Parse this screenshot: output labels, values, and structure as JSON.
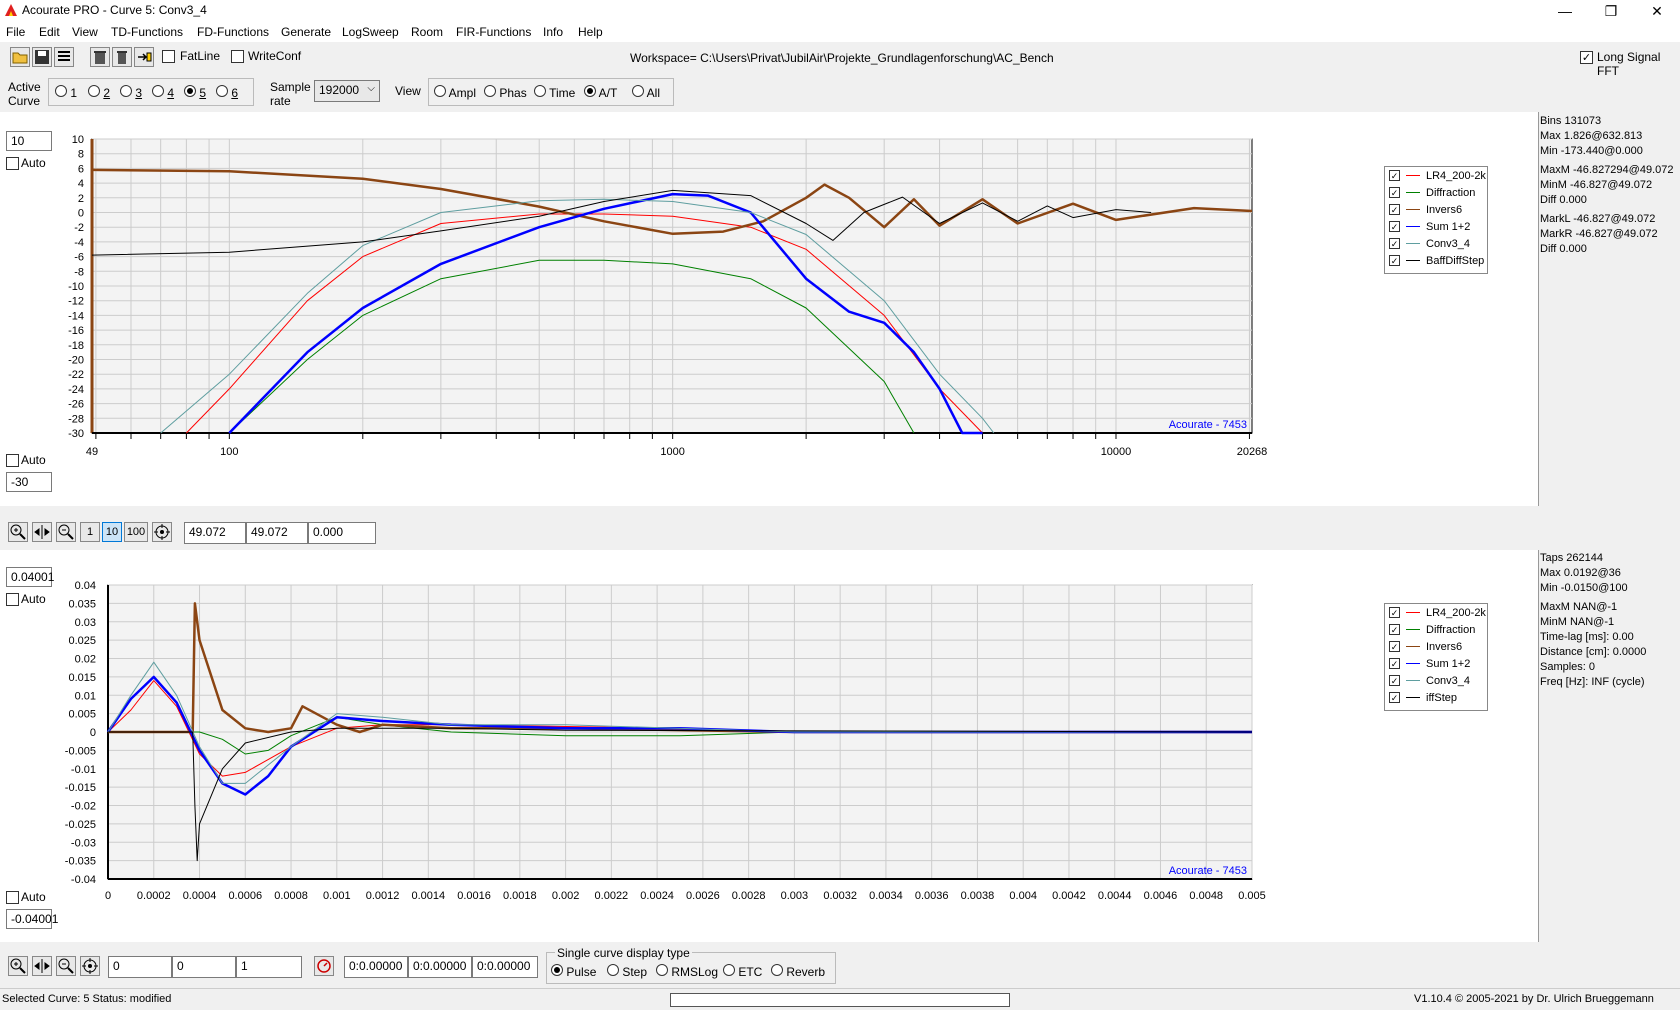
{
  "window": {
    "title": "Acourate PRO - Curve 5: Conv3_4",
    "minimize": "—",
    "restore": "❐",
    "close": "✕"
  },
  "menu": [
    "File",
    "Edit",
    "View",
    "TD-Functions",
    "FD-Functions",
    "Generate",
    "LogSweep",
    "Room",
    "FIR-Functions",
    "Info",
    "Help"
  ],
  "toolbar": {
    "fatline_label": "FatLine",
    "writeconf_label": "WriteConf",
    "workspace": "Workspace= C:\\Users\\Privat\\JubilAir\\Projekte_Grundlagenforschung\\AC_Bench",
    "long_signal_fft_label": "Long Signal FFT"
  },
  "controls": {
    "active_curve_label": "Active Curve",
    "curves": [
      "1",
      "2",
      "3",
      "4",
      "5",
      "6"
    ],
    "active_curve": "5",
    "sample_rate_label": "Sample rate",
    "sample_rate": "192000",
    "view_label": "View",
    "views": [
      "Ampl",
      "Phas",
      "Time",
      "A/T",
      "All"
    ],
    "active_view": "A/T"
  },
  "top_plot": {
    "ymax_value": "10",
    "ymin_value": "-30",
    "auto_label": "Auto",
    "watermark": "Acourate - 7453",
    "yticks": [
      "10",
      "8",
      "6",
      "4",
      "2",
      "0",
      "-2",
      "-4",
      "-6",
      "-8",
      "-10",
      "-12",
      "-14",
      "-16",
      "-18",
      "-20",
      "-22",
      "-24",
      "-26",
      "-28",
      "-30"
    ],
    "xticks": [
      {
        "label": "49",
        "f": 49
      },
      {
        "label": "100",
        "f": 100
      },
      {
        "label": "1000",
        "f": 1000
      },
      {
        "label": "10000",
        "f": 10000
      },
      {
        "label": "20268",
        "f": 20268
      }
    ],
    "info": [
      "Bins 131073",
      "Max 1.826@632.813",
      "Min -173.440@0.000",
      "",
      "MaxM -46.827294@49.072",
      "MinM -46.827@49.072",
      "Diff 0.000",
      "",
      "MarkL -46.827@49.072",
      "MarkR -46.827@49.072",
      "Diff 0.000"
    ]
  },
  "mid_toolbar": {
    "zoom_1": "1",
    "zoom_10": "10",
    "zoom_100": "100",
    "field1": "49.072",
    "field2": "49.072",
    "field3": "0.000"
  },
  "bottom_plot": {
    "ymax_value": "0.04001",
    "ymin_value": "-0.04001",
    "auto_label": "Auto",
    "watermark": "Acourate - 7453",
    "yticks": [
      "0.04",
      "0.035",
      "0.03",
      "0.025",
      "0.02",
      "0.015",
      "0.01",
      "0.005",
      "0",
      "-0.005",
      "-0.01",
      "-0.015",
      "-0.02",
      "-0.025",
      "-0.03",
      "-0.035",
      "-0.04"
    ],
    "xticks": [
      "0",
      "0.0002",
      "0.0004",
      "0.0006",
      "0.0008",
      "0.001",
      "0.0012",
      "0.0014",
      "0.0016",
      "0.0018",
      "0.002",
      "0.0022",
      "0.0024",
      "0.0026",
      "0.0028",
      "0.003",
      "0.0032",
      "0.0034",
      "0.0036",
      "0.0038",
      "0.004",
      "0.0042",
      "0.0044",
      "0.0046",
      "0.0048",
      "0.005"
    ],
    "info": [
      "Taps 262144",
      "Max 0.0192@36",
      "Min -0.0150@100",
      "",
      "MaxM NAN@-1",
      "MinM NAN@-1",
      "Time-lag [ms]: 0.00",
      "Distance [cm]: 0.0000",
      "Samples:  0",
      "Freq [Hz]: INF (cycle)"
    ]
  },
  "legend_top": [
    {
      "name": "LR4_200-2k",
      "color": "#ff0000"
    },
    {
      "name": "Diffraction",
      "color": "#008000"
    },
    {
      "name": "Invers6",
      "color": "#8b4513"
    },
    {
      "name": "Sum 1+2",
      "color": "#0000ff"
    },
    {
      "name": "Conv3_4",
      "color": "#5f9ea0"
    },
    {
      "name": "BaffDiffStep",
      "color": "#000000"
    }
  ],
  "legend_bottom": [
    {
      "name": "LR4_200-2k",
      "color": "#ff0000"
    },
    {
      "name": "Diffraction",
      "color": "#008000"
    },
    {
      "name": "Invers6",
      "color": "#8b4513"
    },
    {
      "name": "Sum 1+2",
      "color": "#0000ff"
    },
    {
      "name": "Conv3_4",
      "color": "#5f9ea0"
    },
    {
      "name": "iffStep",
      "color": "#000000"
    }
  ],
  "bottom_toolbar": {
    "f1": "0",
    "f2": "0",
    "f3": "1",
    "t1": "0:0.00000",
    "t2": "0:0.00000",
    "t3": "0:0.00000",
    "display_type_label": "Single curve display type",
    "display_types": [
      "Pulse",
      "Step",
      "RMSLog",
      "ETC",
      "Reverb"
    ],
    "active_display_type": "Pulse"
  },
  "status": {
    "text": "Selected Curve: 5   Status: modified",
    "version": "V1.10.4 © 2005-2021 by Dr. Ulrich Brueggemann"
  },
  "chart_data": [
    {
      "type": "line",
      "xscale": "log",
      "xlim": [
        49,
        20268
      ],
      "ylim": [
        -30,
        10
      ],
      "series": [
        {
          "name": "LR4_200-2k",
          "x": [
            80,
            100,
            150,
            200,
            300,
            500,
            700,
            1000,
            1500,
            2000,
            3000,
            4000,
            5000
          ],
          "y": [
            -30,
            -24,
            -12,
            -6,
            -1.5,
            -0.2,
            -0.2,
            -0.5,
            -2,
            -5,
            -14,
            -24,
            -30
          ]
        },
        {
          "name": "Diffraction",
          "x": [
            100,
            150,
            200,
            300,
            500,
            700,
            1000,
            1500,
            2000,
            3000,
            3500
          ],
          "y": [
            -30,
            -20,
            -14,
            -9,
            -6.5,
            -6.5,
            -7,
            -9,
            -13,
            -23,
            -30
          ]
        },
        {
          "name": "Invers6",
          "x": [
            49,
            100,
            200,
            300,
            500,
            700,
            1000,
            1300,
            1600,
            2000,
            2200,
            2500,
            3000,
            3500,
            4000,
            5000,
            6000,
            8000,
            10000,
            15000,
            20268
          ],
          "y": [
            5.8,
            5.6,
            4.6,
            3.2,
            0.8,
            -1.2,
            -2.9,
            -2.6,
            -1.2,
            2,
            3.8,
            2,
            -2,
            1.8,
            -1.8,
            1.8,
            -1.5,
            1.2,
            -1,
            0.6,
            0.2
          ]
        },
        {
          "name": "Sum 1+2",
          "x": [
            100,
            150,
            200,
            300,
            500,
            700,
            1000,
            1200,
            1500,
            2000,
            2500,
            3000,
            3500,
            4000,
            4500,
            5000
          ],
          "y": [
            -30,
            -19,
            -13,
            -7,
            -2,
            0.5,
            2.5,
            2.3,
            0,
            -9,
            -13.5,
            -15,
            -19,
            -24,
            -30,
            -30
          ]
        },
        {
          "name": "Conv3_4",
          "x": [
            70,
            100,
            150,
            200,
            300,
            500,
            700,
            1000,
            1500,
            2000,
            3000,
            4000,
            5000,
            5300
          ],
          "y": [
            -30,
            -22,
            -11,
            -4.5,
            0,
            1.6,
            1.8,
            1.5,
            0,
            -3,
            -12,
            -22,
            -28,
            -30
          ]
        },
        {
          "name": "BaffDiffStep",
          "x": [
            49,
            100,
            200,
            300,
            500,
            700,
            1000,
            1500,
            2000,
            2300,
            2700,
            3300,
            4000,
            5000,
            6000,
            7000,
            8000,
            10000,
            12000
          ],
          "y": [
            -5.8,
            -5.4,
            -4,
            -2.5,
            -0.5,
            1.5,
            3,
            2.3,
            -1.5,
            -3.8,
            0,
            2.1,
            -1.5,
            1.3,
            -1.2,
            0.9,
            -0.7,
            0.4,
            0
          ]
        }
      ]
    },
    {
      "type": "line",
      "xlim": [
        0,
        0.005
      ],
      "ylim": [
        -0.04,
        0.04
      ],
      "series": [
        {
          "name": "LR4_200-2k",
          "x": [
            0,
            0.0001,
            0.0002,
            0.0003,
            0.0004,
            0.0005,
            0.0006,
            0.0008,
            0.001,
            0.0012,
            0.0015,
            0.002,
            0.0025,
            0.003,
            0.005
          ],
          "y": [
            0,
            0.006,
            0.014,
            0.007,
            -0.006,
            -0.012,
            -0.011,
            -0.004,
            0.001,
            0.002,
            0.002,
            0.0015,
            0.001,
            0,
            0
          ]
        },
        {
          "name": "Diffraction",
          "x": [
            0,
            0.0004,
            0.0005,
            0.0006,
            0.0007,
            0.0008,
            0.001,
            0.0012,
            0.0015,
            0.002,
            0.0025,
            0.003,
            0.005
          ],
          "y": [
            0,
            0,
            -0.002,
            -0.006,
            -0.005,
            -0.001,
            0.004,
            0.002,
            0,
            -0.001,
            -0.001,
            0,
            0
          ]
        },
        {
          "name": "Invers6",
          "x": [
            0,
            0.00037,
            0.00038,
            0.0004,
            0.0005,
            0.0006,
            0.0007,
            0.0008,
            0.00085,
            0.001,
            0.0011,
            0.0012,
            0.0015,
            0.002,
            0.003,
            0.005
          ],
          "y": [
            0,
            0,
            0.035,
            0.025,
            0.006,
            0.001,
            0,
            0.001,
            0.007,
            0.002,
            0,
            0.002,
            0.001,
            0.001,
            0,
            0
          ]
        },
        {
          "name": "Sum 1+2",
          "x": [
            0,
            0.0001,
            0.0002,
            0.0003,
            0.0004,
            0.0005,
            0.0006,
            0.0007,
            0.0008,
            0.001,
            0.0012,
            0.0015,
            0.002,
            0.0025,
            0.003,
            0.004,
            0.005
          ],
          "y": [
            0,
            0.009,
            0.015,
            0.008,
            -0.005,
            -0.014,
            -0.017,
            -0.012,
            -0.004,
            0.004,
            0.003,
            0.002,
            0.001,
            0.001,
            0,
            0,
            0
          ]
        },
        {
          "name": "Conv3_4",
          "x": [
            0,
            0.0001,
            0.0002,
            0.0003,
            0.0004,
            0.0005,
            0.0006,
            0.0008,
            0.001,
            0.0012,
            0.0015,
            0.002,
            0.003,
            0.005
          ],
          "y": [
            0,
            0.01,
            0.019,
            0.01,
            -0.004,
            -0.014,
            -0.014,
            -0.004,
            0.005,
            0.004,
            0.002,
            0.002,
            0,
            0
          ]
        },
        {
          "name": "iffStep",
          "x": [
            0,
            0.00037,
            0.00038,
            0.00039,
            0.0004,
            0.0005,
            0.0006,
            0.0008,
            0.001,
            0.0012,
            0.0015,
            0.002,
            0.005
          ],
          "y": [
            0,
            0,
            -0.02,
            -0.035,
            -0.025,
            -0.01,
            -0.003,
            0,
            0.001,
            0.001,
            0.001,
            0.0005,
            0
          ]
        }
      ]
    }
  ]
}
